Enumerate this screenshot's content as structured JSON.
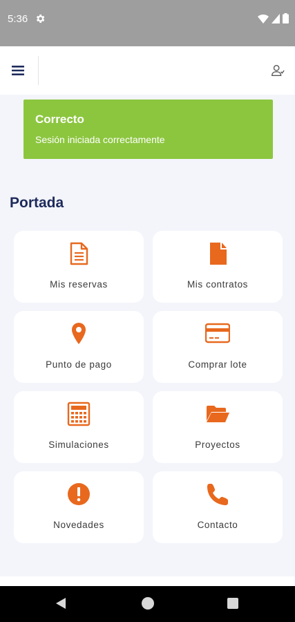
{
  "status_bar": {
    "time": "5:36"
  },
  "alert": {
    "title": "Correcto",
    "message": "Sesión iniciada correctamente"
  },
  "page": {
    "title": "Portada"
  },
  "colors": {
    "accent": "#e8681e",
    "alert_bg": "#8cc63f",
    "title": "#1d2a5b"
  },
  "cards": [
    {
      "label": "Mis reservas",
      "icon": "document-outline-icon"
    },
    {
      "label": "Mis contratos",
      "icon": "document-solid-icon"
    },
    {
      "label": "Punto de pago",
      "icon": "map-pin-icon"
    },
    {
      "label": "Comprar lote",
      "icon": "credit-card-icon"
    },
    {
      "label": "Simulaciones",
      "icon": "calculator-icon"
    },
    {
      "label": "Proyectos",
      "icon": "folder-open-icon"
    },
    {
      "label": "Novedades",
      "icon": "exclamation-circle-icon"
    },
    {
      "label": "Contacto",
      "icon": "phone-icon"
    }
  ]
}
